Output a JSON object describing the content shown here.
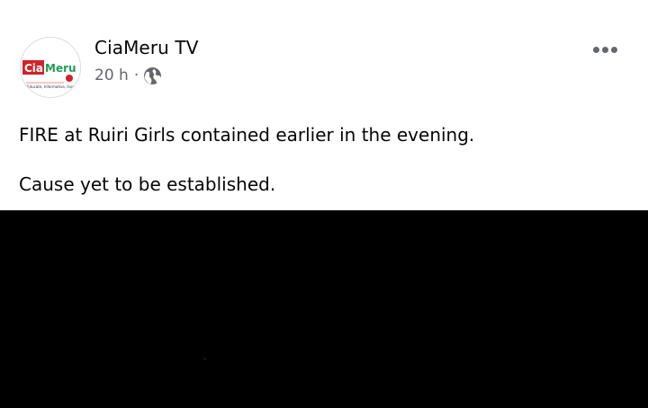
{
  "post": {
    "author": {
      "name": "CiaMeru TV",
      "avatar": {
        "logo_text_left": "Cia",
        "logo_text_right": "Meru",
        "tagline": "Educate, Informative, Inspire",
        "icon": "ciameru-logo"
      }
    },
    "meta": {
      "timestamp": "20 h",
      "separator": "·",
      "privacy_icon": "globe-icon"
    },
    "more_icon": "more-horizontal-icon",
    "text": {
      "line1": "FIRE at Ruiri Girls contained earlier in the evening.",
      "line2": "Cause yet to be established."
    },
    "media": {
      "type": "image",
      "background": "#000000"
    }
  },
  "colors": {
    "primary_text": "#050505",
    "secondary_text": "#65676b",
    "logo_red": "#d2232a",
    "logo_green": "#1f9d55"
  }
}
